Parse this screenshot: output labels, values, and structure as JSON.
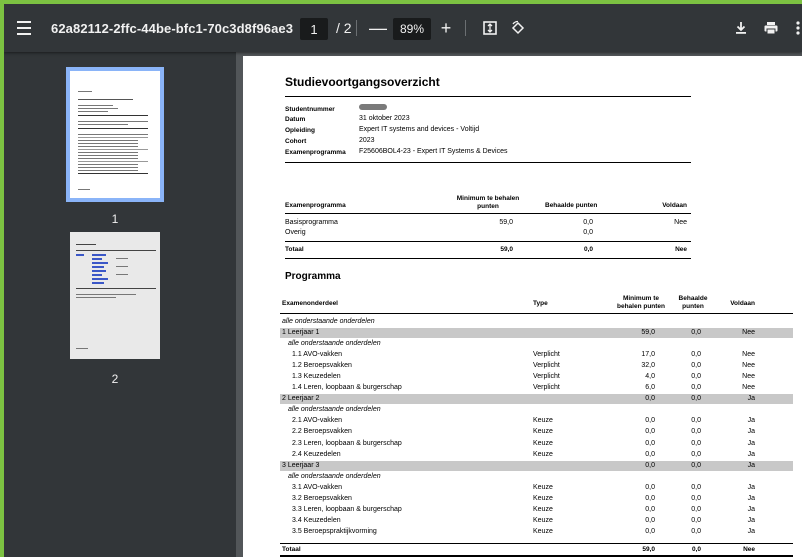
{
  "toolbar": {
    "title": "62a82112-2ffc-44be-bfc1-70c3d8f96ae3",
    "page_current": "1",
    "page_sep": "/ 2",
    "zoom_out": "—",
    "zoom": "89%",
    "zoom_in": "+"
  },
  "sidebar": {
    "thumbs": [
      {
        "label": "1"
      },
      {
        "label": "2"
      }
    ]
  },
  "doc": {
    "title": "Studievoortgangsoverzicht",
    "info": [
      {
        "label": "Studentnummer",
        "value": ""
      },
      {
        "label": "Datum",
        "value": "31 oktober 2023"
      },
      {
        "label": "Opleiding",
        "value": "Expert IT systems and devices - Voltijd"
      },
      {
        "label": "Cohort",
        "value": "2023"
      },
      {
        "label": "Examenprogramma",
        "value": "F25606BOL4-23 - Expert IT Systems & Devices"
      }
    ],
    "summary": {
      "headers": [
        "Examenprogramma",
        "Minimum te behalen",
        "punten",
        "Behaalde punten",
        "Voldaan"
      ],
      "rows": [
        {
          "name": "Basisprogramma",
          "min": "59,0",
          "got": "0,0",
          "ok": "Nee"
        },
        {
          "name": "Overig",
          "min": "",
          "got": "0,0",
          "ok": ""
        }
      ],
      "total": {
        "name": "Totaal",
        "min": "59,0",
        "got": "0,0",
        "ok": "Nee"
      }
    },
    "programma": {
      "title": "Programma",
      "headers": [
        "Examenonderdeel",
        "Type",
        "Minimum te",
        "behalen punten",
        "Behaalde",
        "punten",
        "Voldaan"
      ],
      "all_label": "alle onderstaande onderdelen",
      "years": [
        {
          "name": "1  Leerjaar 1",
          "min": "59,0",
          "got": "0,0",
          "ok": "Nee",
          "sub": "alle onderstaande onderdelen",
          "items": [
            {
              "name": "1.1  AVO-vakken",
              "type": "Verplicht",
              "min": "17,0",
              "got": "0,0",
              "ok": "Nee"
            },
            {
              "name": "1.2  Beroepsvakken",
              "type": "Verplicht",
              "min": "32,0",
              "got": "0,0",
              "ok": "Nee"
            },
            {
              "name": "1.3  Keuzedelen",
              "type": "Verplicht",
              "min": "4,0",
              "got": "0,0",
              "ok": "Nee"
            },
            {
              "name": "1.4  Leren, loopbaan & burgerschap",
              "type": "Verplicht",
              "min": "6,0",
              "got": "0,0",
              "ok": "Nee"
            }
          ]
        },
        {
          "name": "2  Leerjaar 2",
          "min": "0,0",
          "got": "0,0",
          "ok": "Ja",
          "sub": "alle onderstaande onderdelen",
          "items": [
            {
              "name": "2.1  AVO-vakken",
              "type": "Keuze",
              "min": "0,0",
              "got": "0,0",
              "ok": "Ja"
            },
            {
              "name": "2.2  Beroepsvakken",
              "type": "Keuze",
              "min": "0,0",
              "got": "0,0",
              "ok": "Ja"
            },
            {
              "name": "2.3  Leren, loopbaan & burgerschap",
              "type": "Keuze",
              "min": "0,0",
              "got": "0,0",
              "ok": "Ja"
            },
            {
              "name": "2.4  Keuzedelen",
              "type": "Keuze",
              "min": "0,0",
              "got": "0,0",
              "ok": "Ja"
            }
          ]
        },
        {
          "name": "3  Leerjaar 3",
          "min": "0,0",
          "got": "0,0",
          "ok": "Ja",
          "sub": "alle onderstaande onderdelen",
          "items": [
            {
              "name": "3.1  AVO-vakken",
              "type": "Keuze",
              "min": "0,0",
              "got": "0,0",
              "ok": "Ja"
            },
            {
              "name": "3.2  Beroepsvakken",
              "type": "Keuze",
              "min": "0,0",
              "got": "0,0",
              "ok": "Ja"
            },
            {
              "name": "3.3  Leren, loopbaan & burgerschap",
              "type": "Keuze",
              "min": "0,0",
              "got": "0,0",
              "ok": "Ja"
            },
            {
              "name": "3.4  Keuzedelen",
              "type": "Keuze",
              "min": "0,0",
              "got": "0,0",
              "ok": "Ja"
            },
            {
              "name": "3.5  Beroepspraktijkvorming",
              "type": "Keuze",
              "min": "0,0",
              "got": "0,0",
              "ok": "Ja"
            }
          ]
        }
      ],
      "total": {
        "name": "Totaal",
        "min": "59,0",
        "got": "0,0",
        "ok": "Nee"
      }
    }
  }
}
